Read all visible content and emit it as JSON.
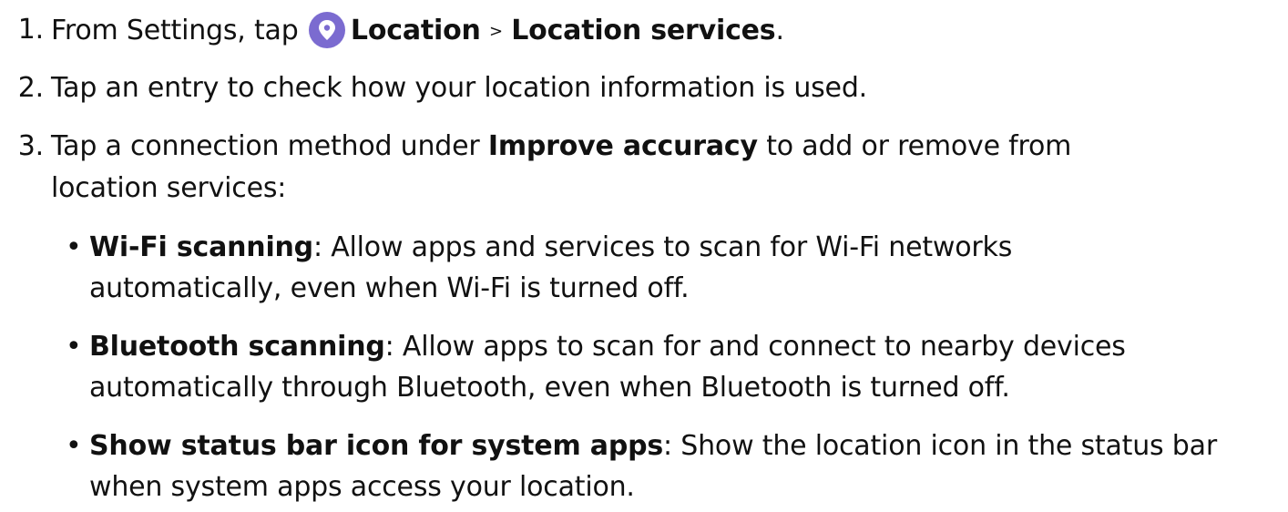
{
  "steps": [
    {
      "number": "1.",
      "text_pre": "From Settings, tap",
      "icon": "location-pin-icon",
      "bold_a": "Location",
      "separator": ">",
      "bold_b": "Location services",
      "text_post": "."
    },
    {
      "number": "2.",
      "text": "Tap an entry to check how your location information is used."
    },
    {
      "number": "3.",
      "text_pre": "Tap a connection method under",
      "bold": "Improve accuracy",
      "text_post": "to add or remove from",
      "text_line2": "location services:"
    }
  ],
  "bullets": [
    {
      "bullet": "•",
      "title": "Wi-Fi scanning",
      "text_line1": ": Allow apps and services to scan for Wi-Fi networks",
      "text_line2": "automatically, even when Wi-Fi is turned off."
    },
    {
      "bullet": "•",
      "title": "Bluetooth scanning",
      "text_line1": ": Allow apps to scan for and connect to nearby devices",
      "text_line2": "automatically through Bluetooth, even when Bluetooth is turned off."
    },
    {
      "bullet": "•",
      "title": "Show status bar icon for system apps",
      "text_line1": ": Show the location icon in the status bar",
      "text_line2": "when system apps access your location."
    }
  ],
  "colors": {
    "text": "#111111",
    "icon_bg": "#7b6bd0"
  }
}
